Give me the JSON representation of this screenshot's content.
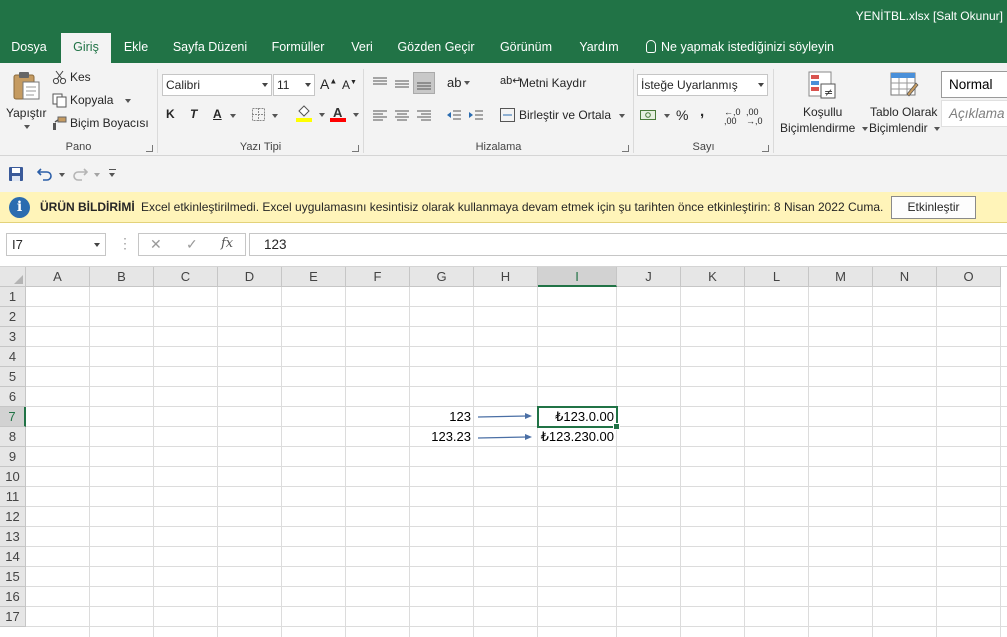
{
  "window": {
    "title": "YENİTBL.xlsx  [Salt Okunur]"
  },
  "tabs": [
    {
      "label": "Dosya"
    },
    {
      "label": "Giriş"
    },
    {
      "label": "Ekle"
    },
    {
      "label": "Sayfa Düzeni"
    },
    {
      "label": "Formüller"
    },
    {
      "label": "Veri"
    },
    {
      "label": "Gözden Geçir"
    },
    {
      "label": "Görünüm"
    },
    {
      "label": "Yardım"
    }
  ],
  "tell_me": "Ne yapmak istediğinizi söyleyin",
  "ribbon": {
    "clipboard": {
      "paste": "Yapıştır",
      "cut": "Kes",
      "copy": "Kopyala",
      "format_painter": "Biçim Boyacısı",
      "label": "Pano"
    },
    "font": {
      "name": "Calibri",
      "size": "11",
      "bold": "K",
      "italic": "T",
      "underline": "A",
      "label": "Yazı Tipi",
      "fill_color": "#ffff00",
      "font_color": "#ff0000"
    },
    "alignment": {
      "wrap_text": "Metni Kaydır",
      "merge_center": "Birleştir ve Ortala",
      "label": "Hizalama"
    },
    "number": {
      "format": "İsteğe Uyarlanmış",
      "percent": "%",
      "comma": ",",
      "label": "Sayı"
    },
    "styles": {
      "conditional_line1": "Koşullu",
      "conditional_line2": "Biçimlendirme",
      "table_line1": "Tablo Olarak",
      "table_line2": "Biçimlendir",
      "normal": "Normal",
      "explanatory": "Açıklama"
    }
  },
  "message_bar": {
    "title": "ÜRÜN BİLDİRİMİ",
    "text": "Excel etkinleştirilmedi. Excel uygulamasını kesintisiz olarak kullanmaya devam etmek için şu tarihten önce etkinleştirin: 8 Nisan 2022 Cuma.",
    "button": "Etkinleştir"
  },
  "formula_bar": {
    "name_box": "I7",
    "cancel": "✕",
    "enter": "✓",
    "fx": "fx",
    "formula": "123"
  },
  "sheet": {
    "columns": [
      "A",
      "B",
      "C",
      "D",
      "E",
      "F",
      "G",
      "H",
      "I",
      "J",
      "K",
      "L",
      "M",
      "N",
      "O"
    ],
    "rows": [
      "1",
      "2",
      "3",
      "4",
      "5",
      "6",
      "7",
      "8",
      "9",
      "10",
      "11",
      "12",
      "13",
      "14",
      "15",
      "16",
      "17"
    ],
    "selected_column": "I",
    "selected_row": "7",
    "cells": {
      "G7": "123",
      "G8": "123.23",
      "I7": "₺123.0.00",
      "I8": "₺123.230.00"
    },
    "accent_color": "#217346",
    "arrow_color": "#4a6fa5"
  }
}
